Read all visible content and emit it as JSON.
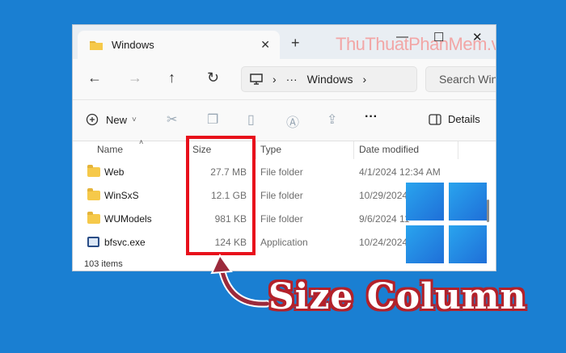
{
  "window": {
    "tab_title": "Windows",
    "tab_close": "✕",
    "new_tab": "+",
    "watermark": "ThuThuatPhanMem.vn",
    "minimize": "—",
    "maximize": "☐",
    "close": "✕"
  },
  "nav": {
    "back": "←",
    "forward": "→",
    "up": "↑",
    "refresh": "↻",
    "address_sep": "›",
    "address_more": "···",
    "address_folder": "Windows",
    "address_chevron": "›",
    "search_placeholder": "Search Win"
  },
  "toolbar": {
    "new_label": "New",
    "new_chevron": "˅",
    "more": "···",
    "details_label": "Details"
  },
  "columns": {
    "name": "Name",
    "size": "Size",
    "type": "Type",
    "date": "Date modified"
  },
  "rows": [
    {
      "name": "Web",
      "size": "27.7 MB",
      "type": "File folder",
      "date": "4/1/2024 12:34 AM",
      "icon": "folder-icon"
    },
    {
      "name": "WinSxS",
      "size": "12.1 GB",
      "type": "File folder",
      "date": "10/29/2024",
      "icon": "folder-icon"
    },
    {
      "name": "WUModels",
      "size": "981 KB",
      "type": "File folder",
      "date": "9/6/2024 11",
      "icon": "folder-icon"
    },
    {
      "name": "bfsvc.exe",
      "size": "124 KB",
      "type": "Application",
      "date": "10/24/2024",
      "icon": "exe-icon"
    }
  ],
  "status": "103 items",
  "caption": "Size Column",
  "colors": {
    "background": "#1a7fd2",
    "highlight": "#e8101b",
    "caption_outline": "#b3212a",
    "arrow": "#9b2a3b"
  }
}
